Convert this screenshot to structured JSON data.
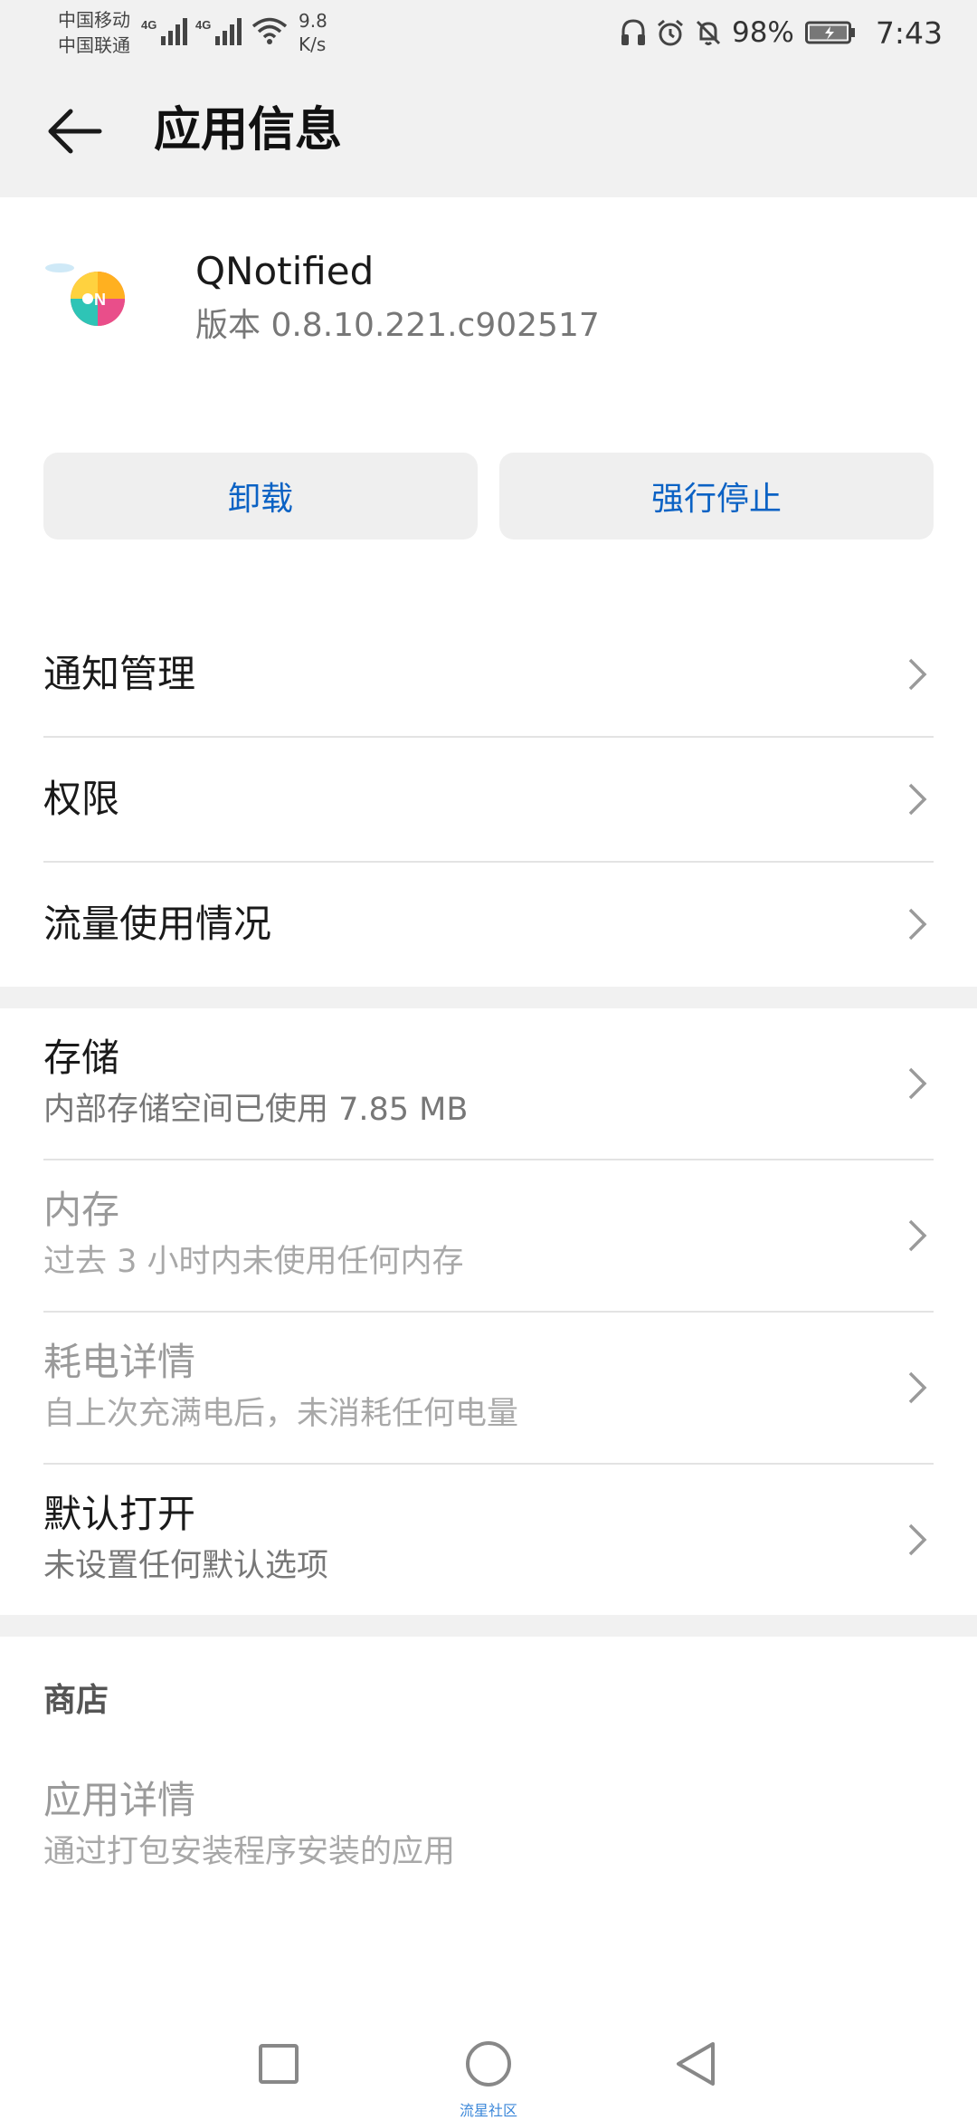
{
  "status_bar": {
    "carrier1": "中国移动",
    "carrier2": "中国联通",
    "network1": "4G",
    "network2": "4G",
    "speed_value": "9.8",
    "speed_unit": "K/s",
    "battery": "98%",
    "time": "7:43",
    "icons": [
      "headphones-icon",
      "alarm-icon",
      "mute-bell-icon",
      "battery-charging-icon"
    ]
  },
  "header": {
    "title": "应用信息"
  },
  "app": {
    "name": "QNotified",
    "version": "版本 0.8.10.221.c902517"
  },
  "buttons": {
    "uninstall": "卸载",
    "force_stop": "强行停止"
  },
  "menu": [
    {
      "label": "通知管理"
    },
    {
      "label": "权限"
    },
    {
      "label": "流量使用情况"
    }
  ],
  "details": [
    {
      "title": "存储",
      "subtitle": "内部存储空间已使用 7.85 MB",
      "enabled": true
    },
    {
      "title": "内存",
      "subtitle": "过去 3 小时内未使用任何内存",
      "enabled": false
    },
    {
      "title": "耗电详情",
      "subtitle": "自上次充满电后，未消耗任何电量",
      "enabled": false
    },
    {
      "title": "默认打开",
      "subtitle": "未设置任何默认选项",
      "enabled": true
    }
  ],
  "store": {
    "header": "商店",
    "item_title": "应用详情",
    "item_subtitle": "通过打包安装程序安装的应用"
  },
  "nav": {
    "watermark": "流星社区"
  },
  "colors": {
    "accent": "#0b62c4",
    "surface": "#f1f1f1"
  }
}
